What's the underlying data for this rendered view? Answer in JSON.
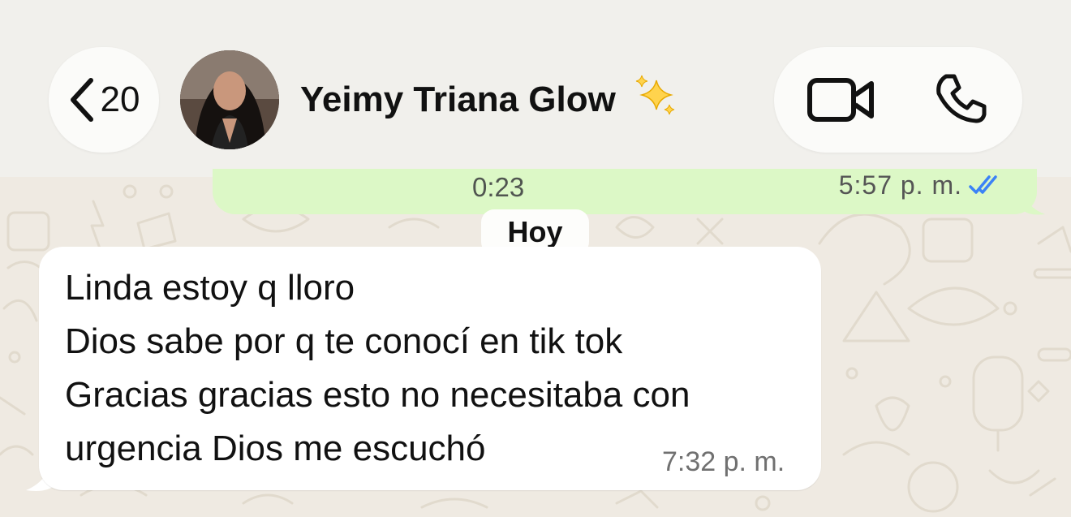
{
  "header": {
    "back_count": "20",
    "contact_name": "Yeimy Triana Glow",
    "name_emoji": "sparkles-icon"
  },
  "call_actions": {
    "video_icon": "video-camera-icon",
    "phone_icon": "phone-icon"
  },
  "previous_message": {
    "duration": "0:23",
    "time": "5:57 p. m.",
    "status": "read"
  },
  "date_separator": "Hoy",
  "message": {
    "lines": [
      "Linda estoy q lloro",
      "Dios sabe por q te conocí en tik tok",
      "Gracias gracias esto no necesitaba con",
      "urgencia Dios me escuchó"
    ],
    "time": "7:32 p. m."
  },
  "colors": {
    "wallpaper": "#efeae2",
    "header": "#f1f0ec",
    "outgoing_bubble": "#dcf8c6",
    "read_ticks": "#3b82f6"
  }
}
